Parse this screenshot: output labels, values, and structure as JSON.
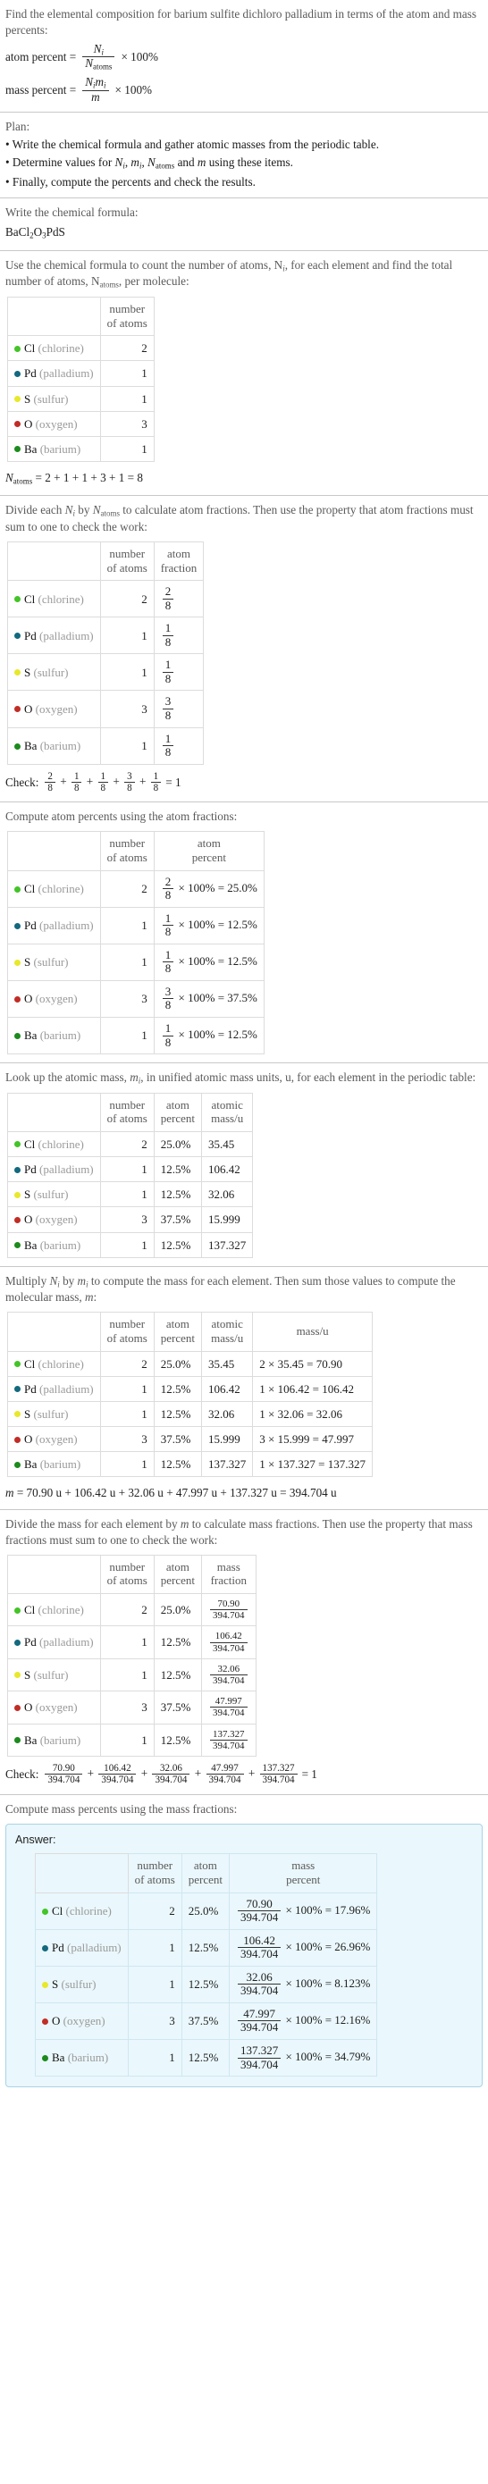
{
  "problem": {
    "statement": "Find the elemental composition for barium sulfite dichloro palladium in terms of the atom and mass percents:",
    "atom_percent_label": "atom percent =",
    "mass_percent_label": "mass percent =",
    "atom_percent_num": "N",
    "atom_percent_num_sub": "i",
    "atom_percent_den": "N",
    "atom_percent_den_sub": "atoms",
    "mass_percent_num": "N",
    "mass_percent_num_sub": "i",
    "mass_percent_num2": "m",
    "mass_percent_num2_sub": "i",
    "mass_percent_den": "m",
    "times100": "× 100%"
  },
  "plan": {
    "heading": "Plan:",
    "items": [
      "• Write the chemical formula and gather atomic masses from the periodic table.",
      "• Determine values for N",
      "• Finally, compute the percents and check the results."
    ],
    "item2_parts": {
      "a": "• Determine values for ",
      "b": "N",
      "b_sub": "i",
      "c": ", ",
      "d": "m",
      "d_sub": "i",
      "e": ", ",
      "f": "N",
      "f_sub": "atoms",
      "g": " and ",
      "h": "m",
      "i": " using these items."
    }
  },
  "formula_section": {
    "prompt": "Write the chemical formula:",
    "formula_parts": [
      {
        "t": "BaCl",
        "sub": false
      },
      {
        "t": "2",
        "sub": true
      },
      {
        "t": "O",
        "sub": false
      },
      {
        "t": "3",
        "sub": true
      },
      {
        "t": "PdS",
        "sub": false
      }
    ]
  },
  "elements": [
    {
      "symbol": "Cl",
      "name": "(chlorine)",
      "color": "#43c428",
      "count": "2",
      "fraction_num": "2",
      "fraction_den": "8",
      "atom_percent": "25.0%",
      "atomic_mass": "35.45",
      "mass_expr": "2 × 35.45 = 70.90",
      "mass": "70.90",
      "mass_percent": "17.96%"
    },
    {
      "symbol": "Pd",
      "name": "(palladium)",
      "color": "#13697e",
      "count": "1",
      "fraction_num": "1",
      "fraction_den": "8",
      "atom_percent": "12.5%",
      "atomic_mass": "106.42",
      "mass_expr": "1 × 106.42 = 106.42",
      "mass": "106.42",
      "mass_percent": "26.96%"
    },
    {
      "symbol": "S",
      "name": "(sulfur)",
      "color": "#e8e82a",
      "count": "1",
      "fraction_num": "1",
      "fraction_den": "8",
      "atom_percent": "12.5%",
      "atomic_mass": "32.06",
      "mass_expr": "1 × 32.06 = 32.06",
      "mass": "32.06",
      "mass_percent": "8.123%"
    },
    {
      "symbol": "O",
      "name": "(oxygen)",
      "color": "#c12d26",
      "count": "3",
      "fraction_num": "3",
      "fraction_den": "8",
      "atom_percent": "37.5%",
      "atomic_mass": "15.999",
      "mass_expr": "3 × 15.999 = 47.997",
      "mass": "47.997",
      "mass_percent": "12.16%"
    },
    {
      "symbol": "Ba",
      "name": "(barium)",
      "color": "#1d8a1d",
      "count": "1",
      "fraction_num": "1",
      "fraction_den": "8",
      "atom_percent": "12.5%",
      "atomic_mass": "137.327",
      "mass_expr": "1 × 137.327 = 137.327",
      "mass": "137.327",
      "mass_percent": "34.79%"
    }
  ],
  "count_section": {
    "prompt_line1": "Use the chemical formula to count the number of atoms, N",
    "prompt_line1_sub": "i",
    "prompt_line1_tail": ", for each element",
    "prompt_line2": "and find the total number of atoms, N",
    "prompt_line2_sub": "atoms",
    "prompt_line2_tail": ", per molecule:",
    "header_blank": "",
    "header_count": "number\nof atoms",
    "header_count_l1": "number",
    "header_count_l2": "of atoms",
    "total_label": "N",
    "total_label_sub": "atoms",
    "total_expr": "= 2 + 1 + 1 + 3 + 1 = 8"
  },
  "fraction_section": {
    "prompt_line1_a": "Divide each ",
    "prompt_line1_b": "N",
    "prompt_line1_b_sub": "i",
    "prompt_line1_c": " by ",
    "prompt_line1_d": "N",
    "prompt_line1_d_sub": "atoms",
    "prompt_line1_e": " to calculate atom fractions. Then use the property that",
    "prompt_line2": "atom fractions must sum to one to check the work:",
    "header_fraction_l1": "atom",
    "header_fraction_l2": "fraction",
    "check_label": "Check:",
    "check_result": "= 1"
  },
  "atom_percent_section": {
    "prompt": "Compute atom percents using the atom fractions:",
    "header_percent_l1": "atom",
    "header_percent_l2": "percent",
    "rows": [
      {
        "expr_tail": "× 100% = 25.0%"
      },
      {
        "expr_tail": "× 100% = 12.5%"
      },
      {
        "expr_tail": "× 100% = 12.5%"
      },
      {
        "expr_tail": "× 100% = 37.5%"
      },
      {
        "expr_tail": "× 100% = 12.5%"
      }
    ]
  },
  "atomic_mass_section": {
    "prompt_line1_a": "Look up the atomic mass, ",
    "prompt_line1_b": "m",
    "prompt_line1_b_sub": "i",
    "prompt_line1_c": ", in unified atomic mass units, u, for each element in",
    "prompt_line2": "the periodic table:",
    "header_mass_l1": "atomic",
    "header_mass_l2": "mass/u"
  },
  "molecular_mass_section": {
    "prompt_line1_a": "Multiply ",
    "prompt_line1_b": "N",
    "prompt_line1_b_sub": "i",
    "prompt_line1_c": " by ",
    "prompt_line1_d": "m",
    "prompt_line1_d_sub": "i",
    "prompt_line1_e": " to compute the mass for each element. Then sum those values",
    "prompt_line2_a": "to compute the molecular mass, ",
    "prompt_line2_b": "m",
    "prompt_line2_c": ":",
    "header_massu": "mass/u",
    "total_label": "m",
    "total_expr": "= 70.90 u + 106.42 u + 32.06 u + 47.997 u + 137.327 u = 394.704 u"
  },
  "mass_fraction_section": {
    "prompt_line1_a": "Divide the mass for each element by ",
    "prompt_line1_b": "m",
    "prompt_line1_c": " to calculate mass fractions. Then use the",
    "prompt_line2": "property that mass fractions must sum to one to check the work:",
    "header_mf_l1": "mass",
    "header_mf_l2": "fraction",
    "denominator": "394.704",
    "check_label": "Check:",
    "check_result": "= 1"
  },
  "mass_percent_section": {
    "prompt": "Compute mass percents using the mass fractions:",
    "answer_label": "Answer:",
    "header_mp_l1": "mass",
    "header_mp_l2": "percent",
    "denominator": "394.704",
    "times": "× 100% ="
  }
}
